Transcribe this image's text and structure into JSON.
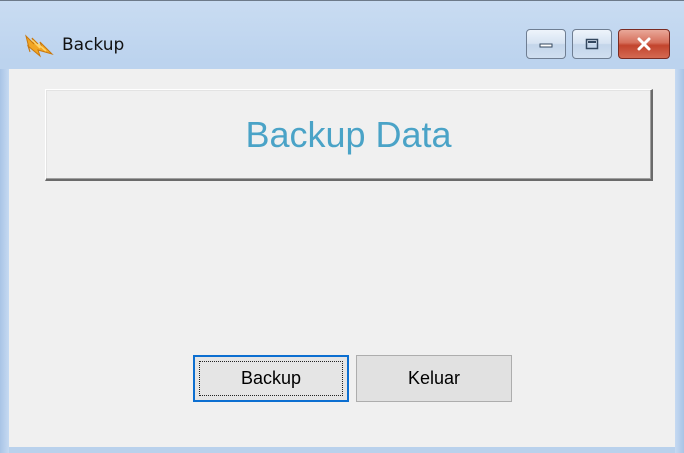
{
  "window": {
    "title": "Backup",
    "icon": "app-lightning-icon",
    "caption_buttons": [
      "minimize-icon",
      "maximize-icon",
      "close-icon"
    ]
  },
  "header": {
    "title": "Backup Data",
    "title_color": "#4aa3c7"
  },
  "buttons": {
    "backup_label": "Backup",
    "exit_label": "Keluar"
  },
  "colors": {
    "focus_border": "#0c6fd1",
    "close_button": "#c2442d",
    "client_background": "#f0f0f0"
  }
}
